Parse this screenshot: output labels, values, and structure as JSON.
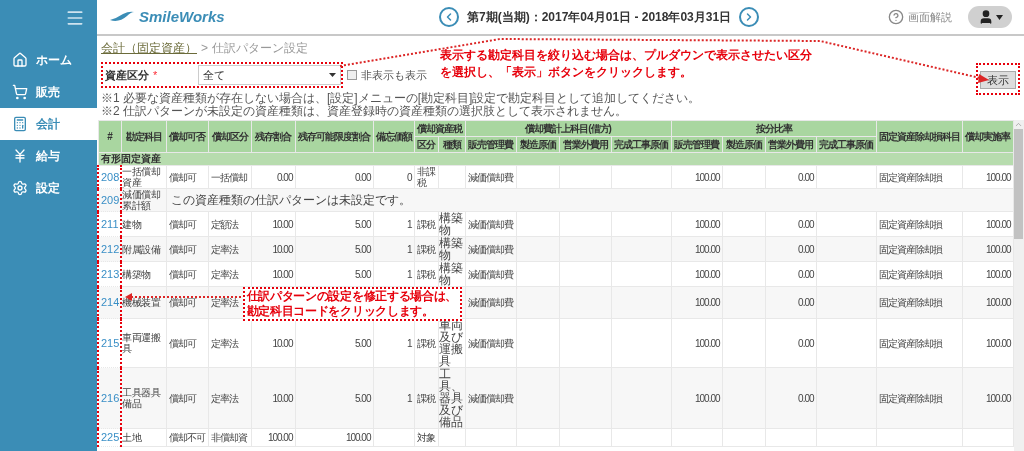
{
  "sidebar": {
    "items": [
      {
        "label": "ホーム",
        "selected": false
      },
      {
        "label": "販売",
        "selected": false
      },
      {
        "label": "会計",
        "selected": true
      },
      {
        "label": "給与",
        "selected": false
      },
      {
        "label": "設定",
        "selected": false
      }
    ]
  },
  "header": {
    "logo": "SmileWorks",
    "period": "第7期(当期)：2017年04月01日 - 2018年03月31日",
    "help": "画面解説"
  },
  "breadcrumb": {
    "items": [
      "会計（固定資産）",
      "仕訳パターン設定"
    ],
    "separator": ">"
  },
  "filter": {
    "label": "資産区分",
    "required_mark": "*",
    "select_value": "全て",
    "checkbox_label": "非表示も表示",
    "checked": false,
    "button": "表示"
  },
  "notes": [
    "※1 必要な資産種類が存在しない場合は、[設定]メニューの[勘定科目]設定で勘定科目として追加してください。",
    "※2 仕訳パターンが未設定の資産種類は、資産登録時の資産種類の選択肢として表示されません。"
  ],
  "annotations": [
    "表示する勘定科目を絞り込む場合は、プルダウンで表示させたい区分を選択し、「表示」ボタンをクリックします。",
    "仕訳パターンの設定を修正する場合は、勘定科目コードをクリックします。"
  ],
  "table": {
    "columns": [
      {
        "label": "#"
      },
      {
        "label": "勘定科目"
      },
      {
        "label": "償却可否"
      },
      {
        "label": "償却区分"
      },
      {
        "label": "残存割合"
      },
      {
        "label": "残存可能限度割合"
      },
      {
        "label": "備忘価額"
      },
      {
        "label": "区分"
      },
      {
        "label": "種類"
      },
      {
        "label": "販売管理費"
      },
      {
        "label": "製造原価"
      },
      {
        "label": "営業外費用"
      },
      {
        "label": "完成工事原価"
      },
      {
        "label": "販売管理費"
      },
      {
        "label": "製造原価"
      },
      {
        "label": "営業外費用"
      },
      {
        "label": "完成工事原価"
      },
      {
        "label": "固定資産除却損科目"
      },
      {
        "label": "償却実施率"
      }
    ],
    "column_groups": [
      {
        "label": "償却資産税"
      },
      {
        "label": "償却費計上科目(借方)"
      },
      {
        "label": "按分比率"
      }
    ],
    "group": "有形固定資産",
    "rows": [
      {
        "kind": "full",
        "cells": [
          "208",
          "一括償却資産",
          "償却可",
          "一括償却",
          "0.00",
          "0.00",
          "0",
          "非課税",
          null,
          "減価償却費",
          null,
          null,
          null,
          "100.00",
          null,
          "0.00",
          null,
          "固定資産除却損",
          "100.00"
        ]
      },
      {
        "kind": "unset",
        "cells": [
          "209",
          "減価償却累計額"
        ],
        "message": "この資産種類の仕訳パターンは未設定です。"
      },
      {
        "kind": "full",
        "cells": [
          "211",
          "建物",
          "償却可",
          "定額法",
          "10.00",
          "5.00",
          "1",
          "課税",
          "構築物",
          "減価償却費",
          null,
          null,
          null,
          "100.00",
          null,
          "0.00",
          null,
          "固定資産除却損",
          "100.00"
        ]
      },
      {
        "kind": "full",
        "cells": [
          "212",
          "附属設備",
          "償却可",
          "定率法",
          "10.00",
          "5.00",
          "1",
          "課税",
          "構築物",
          "減価償却費",
          null,
          null,
          null,
          "100.00",
          null,
          "0.00",
          null,
          "固定資産除却損",
          "100.00"
        ]
      },
      {
        "kind": "full",
        "cells": [
          "213",
          "構築物",
          "償却可",
          "定率法",
          "10.00",
          "5.00",
          "1",
          "課税",
          "構築物",
          "減価償却費",
          null,
          null,
          null,
          "100.00",
          null,
          "0.00",
          null,
          "固定資産除却損",
          "100.00"
        ]
      },
      {
        "kind": "full",
        "cells": [
          "214",
          "機械装置",
          "償却可",
          "定率法",
          null,
          null,
          null,
          null,
          null,
          "減価償却費",
          null,
          null,
          null,
          "100.00",
          null,
          "0.00",
          null,
          "固定資産除却損",
          "100.00"
        ]
      },
      {
        "kind": "full",
        "cells": [
          "215",
          "車両運搬具",
          "償却可",
          "定率法",
          "10.00",
          "5.00",
          "1",
          "課税",
          "車両及び運搬具",
          "減価償却費",
          null,
          null,
          null,
          "100.00",
          null,
          "0.00",
          null,
          "固定資産除却損",
          "100.00"
        ]
      },
      {
        "kind": "full",
        "cells": [
          "216",
          "工具器具備品",
          "償却可",
          "定率法",
          "10.00",
          "5.00",
          "1",
          "課税",
          "工具、器具及び備品",
          "減価償却費",
          null,
          null,
          null,
          "100.00",
          null,
          "0.00",
          null,
          "固定資産除却損",
          "100.00"
        ]
      },
      {
        "kind": "full",
        "cells": [
          "225",
          "土地",
          "償却不可",
          "非償却資",
          "100.00",
          "100.00",
          null,
          "対象",
          null,
          null,
          null,
          null,
          null,
          null,
          null,
          null,
          null,
          null,
          null
        ]
      }
    ]
  }
}
